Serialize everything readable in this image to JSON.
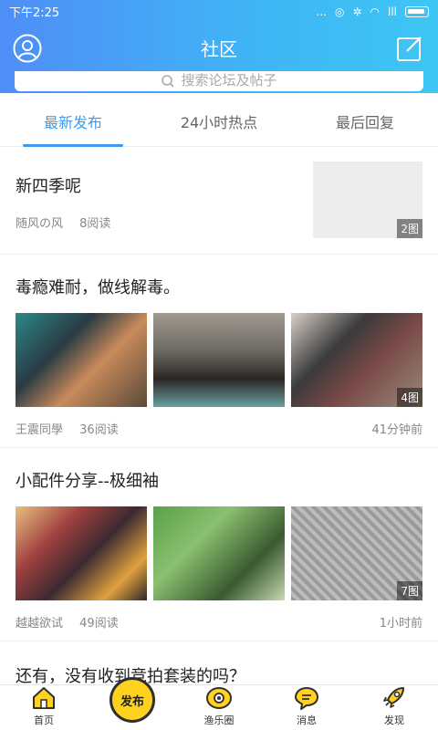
{
  "status_bar": {
    "time": "下午2:25",
    "dots": "...",
    "signal": "lll"
  },
  "header": {
    "title": "社区"
  },
  "search": {
    "placeholder": "搜索论坛及帖子"
  },
  "tabs": [
    {
      "label": "最新发布",
      "active": true
    },
    {
      "label": "24小时热点",
      "active": false
    },
    {
      "label": "最后回复",
      "active": false
    }
  ],
  "posts": [
    {
      "title": "新四季呢",
      "author": "随风の风",
      "reads": "8阅读",
      "image_count": "2图"
    },
    {
      "title": "毒瘾难耐，做线解毒。",
      "author": "王震同學",
      "reads": "36阅读",
      "time": "41分钟前",
      "image_count": "4图"
    },
    {
      "title": "小配件分享--极细袖",
      "author": "越越欲试",
      "reads": "49阅读",
      "time": "1小时前",
      "image_count": "7图"
    },
    {
      "title": "还有，没有收到竞拍套装的吗？"
    }
  ],
  "bottom_nav": {
    "home": "首页",
    "publish": "发布",
    "circle": "渔乐圈",
    "messages": "消息",
    "discover": "发现"
  },
  "colors": {
    "accent": "#3b9bf0",
    "header_start": "#4f8ef7",
    "header_end": "#3ec6f3",
    "publish": "#ffd21f"
  }
}
